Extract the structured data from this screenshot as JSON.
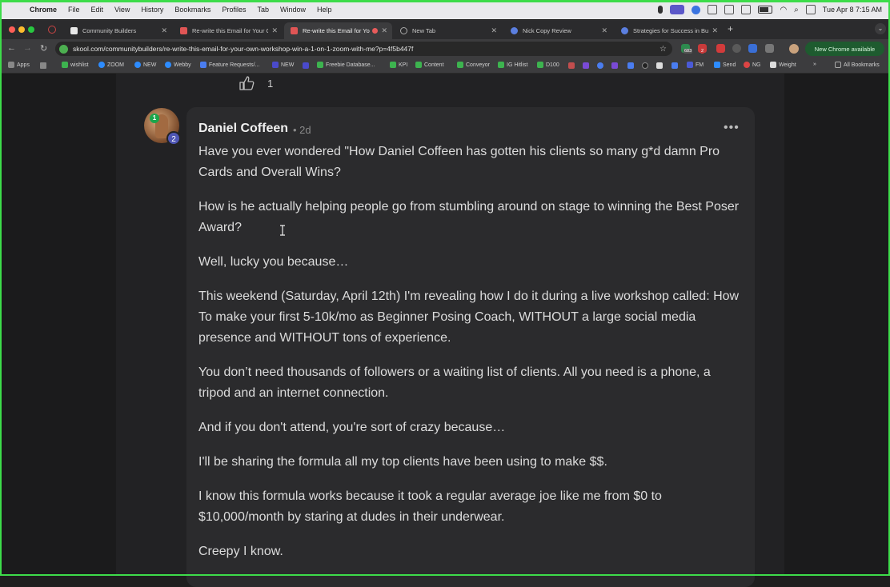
{
  "menubar": {
    "app": "Chrome",
    "items": [
      "File",
      "Edit",
      "View",
      "History",
      "Bookmarks",
      "Profiles",
      "Tab",
      "Window",
      "Help"
    ],
    "clock": "Tue Apr 8  7:15 AM"
  },
  "tabs": [
    {
      "title": "Community Builders",
      "active": false
    },
    {
      "title": "Re-write this Email for Your O",
      "active": false
    },
    {
      "title": "Re-write this Email for Yo",
      "active": true
    },
    {
      "title": "New Tab",
      "active": false
    },
    {
      "title": "Nick Copy Review",
      "active": false
    },
    {
      "title": "Strategies for Success in Bus",
      "active": false
    }
  ],
  "toolbar": {
    "url": "skool.com/communitybuilders/re-write-this-email-for-your-own-workshop-win-a-1-on-1-zoom-with-me?p=4f5b447f",
    "ext_badges": [
      "683",
      "2"
    ],
    "update_label": "New Chrome available"
  },
  "bookmarks": {
    "items": [
      "Apps",
      "wishlist",
      "ZOOM",
      "NEW",
      "Webby",
      "Feature Requests/...",
      "NEW",
      "Freebie Database...",
      "KPI",
      "Content",
      "Conveyor",
      "IG Hitlist",
      "D100",
      "FM",
      "Send",
      "NG",
      "Weight"
    ],
    "overflow": "»",
    "all_label": "All Bookmarks"
  },
  "prev_post": {
    "like_count": "1"
  },
  "post": {
    "author": "Daniel Coffeen",
    "time": "• 2d",
    "rank": "1",
    "level": "2",
    "paragraphs": [
      "Have you ever wondered \"How Daniel Coffeen has gotten his clients so many g*d damn Pro Cards and Overall Wins?",
      "How is he actually helping people go from stumbling around on stage to winning the Best Poser Award?",
      "Well, lucky you because…",
      "This weekend (Saturday, April 12th) I'm revealing how I do it during a live workshop called: How To make your first 5-10k/mo as Beginner Posing Coach, WITHOUT a large social media presence and WITHOUT tons of experience.",
      "You don’t need thousands of followers or a waiting list of clients. All you need is a phone, a tripod and an internet connection.",
      "And if you don't attend, you're sort of crazy because…",
      "I'll be sharing the formula all my top clients have been using to make $$.",
      "I know this formula works because it took a regular average joe like me from $0 to $10,000/month by staring at dudes in their underwear.",
      "Creepy I know."
    ]
  }
}
